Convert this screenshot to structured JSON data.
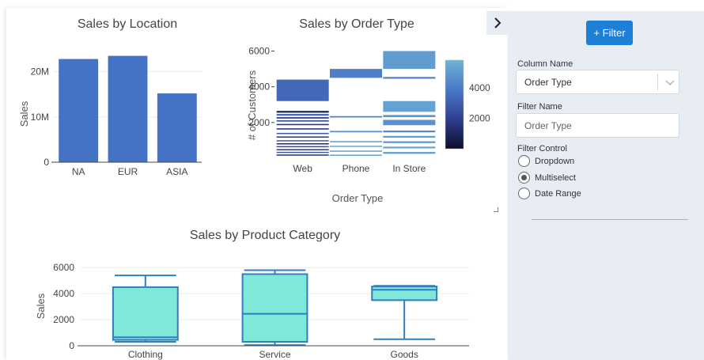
{
  "location_chart": {
    "title": "Sales by Location",
    "ylabel": "Sales",
    "y_ticks": [
      "0",
      "10M",
      "20M"
    ],
    "categories": [
      "NA",
      "EUR",
      "ASIA"
    ]
  },
  "order_type_chart": {
    "title": "Sales by Order Type",
    "ylabel": "# of Customers",
    "xlabel": "Order Type",
    "y_ticks": [
      "2000",
      "4000",
      "6000"
    ],
    "categories": [
      "Web",
      "Phone",
      "In Store"
    ],
    "colorbar_ticks": [
      "2000",
      "4000"
    ]
  },
  "category_chart": {
    "title": "Sales by Product Category",
    "ylabel": "Sales",
    "y_ticks": [
      "0",
      "2000",
      "4000",
      "6000"
    ],
    "categories": [
      "Clothing",
      "Service",
      "Goods"
    ]
  },
  "chart_data": [
    {
      "type": "bar",
      "title": "Sales by Location",
      "xlabel": "",
      "ylabel": "Sales",
      "categories": [
        "NA",
        "EUR",
        "ASIA"
      ],
      "values": [
        22800000,
        23500000,
        15200000
      ],
      "ylim": [
        0,
        25000000
      ],
      "color": "#4472c4",
      "grid": true
    },
    {
      "type": "heatmap",
      "title": "Sales by Order Type",
      "xlabel": "Order Type",
      "ylabel": "# of Customers",
      "categories": [
        "Web",
        "Phone",
        "In Store"
      ],
      "ylim": [
        0,
        6200
      ],
      "colorscale": [
        "#0d0d2b",
        "#2f3f8f",
        "#4a79c7",
        "#6fb4d6"
      ],
      "color_range": [
        0,
        5800
      ],
      "colorbar_ticks": [
        2000,
        4000
      ],
      "bands": [
        {
          "x": "Web",
          "y0": 3200,
          "y1": 4400,
          "value": 3300
        },
        {
          "x": "Web",
          "y0": 2550,
          "y1": 2650,
          "value": 900
        },
        {
          "x": "Web",
          "y0": 2380,
          "y1": 2480,
          "value": 3400
        },
        {
          "x": "Web",
          "y0": 2220,
          "y1": 2300,
          "value": 1900
        },
        {
          "x": "Web",
          "y0": 2050,
          "y1": 2130,
          "value": 2700
        },
        {
          "x": "Web",
          "y0": 1850,
          "y1": 1920,
          "value": 1500
        },
        {
          "x": "Web",
          "y0": 1600,
          "y1": 1680,
          "value": 2600
        },
        {
          "x": "Web",
          "y0": 1350,
          "y1": 1420,
          "value": 2900
        },
        {
          "x": "Web",
          "y0": 1150,
          "y1": 1220,
          "value": 1800
        },
        {
          "x": "Web",
          "y0": 950,
          "y1": 1010,
          "value": 3000
        },
        {
          "x": "Web",
          "y0": 780,
          "y1": 840,
          "value": 1200
        },
        {
          "x": "Web",
          "y0": 620,
          "y1": 680,
          "value": 2400
        },
        {
          "x": "Web",
          "y0": 450,
          "y1": 510,
          "value": 1600
        },
        {
          "x": "Web",
          "y0": 300,
          "y1": 360,
          "value": 2800
        },
        {
          "x": "Web",
          "y0": 150,
          "y1": 210,
          "value": 1400
        },
        {
          "x": "Phone",
          "y0": 4500,
          "y1": 5000,
          "value": 4100
        },
        {
          "x": "Phone",
          "y0": 2280,
          "y1": 2360,
          "value": 4200
        },
        {
          "x": "Phone",
          "y0": 1450,
          "y1": 1530,
          "value": 4600
        },
        {
          "x": "Phone",
          "y0": 900,
          "y1": 960,
          "value": 5000
        },
        {
          "x": "Phone",
          "y0": 650,
          "y1": 700,
          "value": 5400
        },
        {
          "x": "Phone",
          "y0": 380,
          "y1": 430,
          "value": 5100
        },
        {
          "x": "Phone",
          "y0": 150,
          "y1": 200,
          "value": 5300
        },
        {
          "x": "In Store",
          "y0": 5000,
          "y1": 6000,
          "value": 5000
        },
        {
          "x": "In Store",
          "y0": 4450,
          "y1": 4550,
          "value": 4200
        },
        {
          "x": "In Store",
          "y0": 2600,
          "y1": 3200,
          "value": 5200
        },
        {
          "x": "In Store",
          "y0": 2300,
          "y1": 2420,
          "value": 4800
        },
        {
          "x": "In Store",
          "y0": 1850,
          "y1": 2150,
          "value": 4700
        },
        {
          "x": "In Store",
          "y0": 1450,
          "y1": 1550,
          "value": 4500
        },
        {
          "x": "In Store",
          "y0": 1150,
          "y1": 1250,
          "value": 5100
        },
        {
          "x": "In Store",
          "y0": 850,
          "y1": 950,
          "value": 4900
        },
        {
          "x": "In Store",
          "y0": 550,
          "y1": 650,
          "value": 5300
        },
        {
          "x": "In Store",
          "y0": 250,
          "y1": 350,
          "value": 5000
        }
      ]
    },
    {
      "type": "box",
      "title": "Sales by Product Category",
      "xlabel": "",
      "ylabel": "Sales",
      "categories": [
        "Clothing",
        "Service",
        "Goods"
      ],
      "ylim": [
        0,
        6500
      ],
      "fill": "#7fe8d8",
      "stroke": "#2f7fc0",
      "boxes": [
        {
          "min": 300,
          "q1": 450,
          "median": 650,
          "q3": 4500,
          "max": 5400
        },
        {
          "min": 50,
          "q1": 300,
          "median": 2450,
          "q3": 5500,
          "max": 5800
        },
        {
          "min": 500,
          "q1": 3500,
          "median": 4300,
          "q3": 4550,
          "max": 4600
        }
      ]
    }
  ],
  "filter_panel": {
    "add_button": "+ Filter",
    "column_name_label": "Column Name",
    "column_name_value": "Order Type",
    "filter_name_label": "Filter Name",
    "filter_name_placeholder": "Order Type",
    "filter_control_label": "Filter Control",
    "options": [
      "Dropdown",
      "Multiselect",
      "Date Range"
    ],
    "selected_option": "Multiselect"
  }
}
